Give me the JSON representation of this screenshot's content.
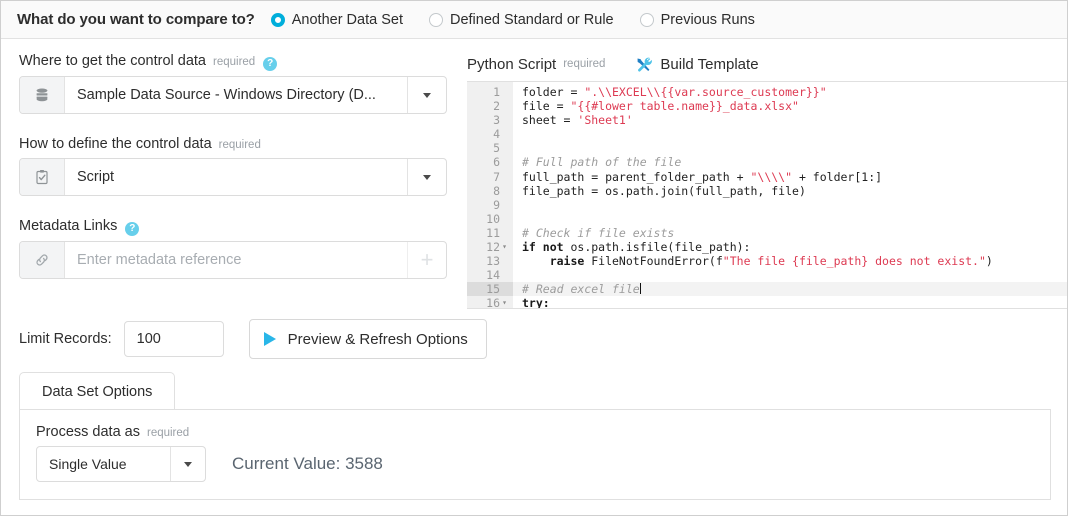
{
  "compare": {
    "question": "What do you want to compare to?",
    "options": [
      {
        "label": "Another Data Set",
        "selected": true
      },
      {
        "label": "Defined Standard or Rule",
        "selected": false
      },
      {
        "label": "Previous Runs",
        "selected": false
      }
    ],
    "accent_color": "#00AEDB"
  },
  "control_source": {
    "label": "Where to get the control data",
    "required": "required",
    "help": "?",
    "icon": "database-icon",
    "value": "Sample Data Source - Windows Directory (D...",
    "caret": "▼"
  },
  "control_definition": {
    "label": "How to define the control data",
    "required": "required",
    "icon": "clipboard-check-icon",
    "value": "Script",
    "caret": "▼"
  },
  "metadata_links": {
    "label": "Metadata Links",
    "help": "?",
    "icon": "link-icon",
    "placeholder": "Enter metadata reference",
    "add": "+"
  },
  "script_panel": {
    "title": "Python Script",
    "required": "required",
    "build_template_label": "Build Template",
    "build_template_icon": "tools-icon",
    "lines": [
      {
        "n": "1",
        "fold": "",
        "active": false,
        "tokens": [
          {
            "t": "pln",
            "v": "folder = "
          },
          {
            "t": "str",
            "v": "\".\\\\EXCEL\\\\{{var.source_customer}}\""
          }
        ]
      },
      {
        "n": "2",
        "fold": "",
        "active": false,
        "tokens": [
          {
            "t": "pln",
            "v": "file = "
          },
          {
            "t": "str",
            "v": "\"{{#lower table.name}}_data.xlsx\""
          }
        ]
      },
      {
        "n": "3",
        "fold": "",
        "active": false,
        "tokens": [
          {
            "t": "pln",
            "v": "sheet = "
          },
          {
            "t": "str",
            "v": "'Sheet1'"
          }
        ]
      },
      {
        "n": "4",
        "fold": "",
        "active": false,
        "tokens": []
      },
      {
        "n": "5",
        "fold": "",
        "active": false,
        "tokens": []
      },
      {
        "n": "6",
        "fold": "",
        "active": false,
        "tokens": [
          {
            "t": "com",
            "v": "# Full path of the file"
          }
        ]
      },
      {
        "n": "7",
        "fold": "",
        "active": false,
        "tokens": [
          {
            "t": "pln",
            "v": "full_path = parent_folder_path + "
          },
          {
            "t": "str",
            "v": "\"\\\\\\\\\""
          },
          {
            "t": "pln",
            "v": " + folder[1:]"
          }
        ]
      },
      {
        "n": "8",
        "fold": "",
        "active": false,
        "tokens": [
          {
            "t": "pln",
            "v": "file_path = os.path.join(full_path, file)"
          }
        ]
      },
      {
        "n": "9",
        "fold": "",
        "active": false,
        "tokens": []
      },
      {
        "n": "10",
        "fold": "",
        "active": false,
        "tokens": []
      },
      {
        "n": "11",
        "fold": "",
        "active": false,
        "tokens": [
          {
            "t": "com",
            "v": "# Check if file exists"
          }
        ]
      },
      {
        "n": "12",
        "fold": "▾",
        "active": false,
        "tokens": [
          {
            "t": "kw",
            "v": "if not"
          },
          {
            "t": "pln",
            "v": " os.path.isfile(file_path):"
          }
        ]
      },
      {
        "n": "13",
        "fold": "",
        "active": false,
        "tokens": [
          {
            "t": "kw",
            "v": "    raise"
          },
          {
            "t": "pln",
            "v": " FileNotFoundError(f"
          },
          {
            "t": "str",
            "v": "\"The file {file_path} does not exist.\""
          },
          {
            "t": "pln",
            "v": ")"
          }
        ]
      },
      {
        "n": "14",
        "fold": "",
        "active": false,
        "tokens": []
      },
      {
        "n": "15",
        "fold": "",
        "active": true,
        "tokens": [
          {
            "t": "com",
            "v": "# Read excel file"
          },
          {
            "t": "cursor",
            "v": ""
          }
        ]
      },
      {
        "n": "16",
        "fold": "▾",
        "active": false,
        "tokens": [
          {
            "t": "kw",
            "v": "try:"
          }
        ]
      }
    ]
  },
  "limit": {
    "label": "Limit Records:",
    "value": "100",
    "preview_button": "Preview & Refresh Options",
    "preview_icon": "play-icon"
  },
  "options_panel": {
    "tabs": [
      {
        "label": "Data Set Options",
        "active": true
      }
    ],
    "process_label": "Process data as",
    "process_required": "required",
    "process_value": "Single Value",
    "process_caret": "▼",
    "current_value": "Current Value: 3588"
  }
}
